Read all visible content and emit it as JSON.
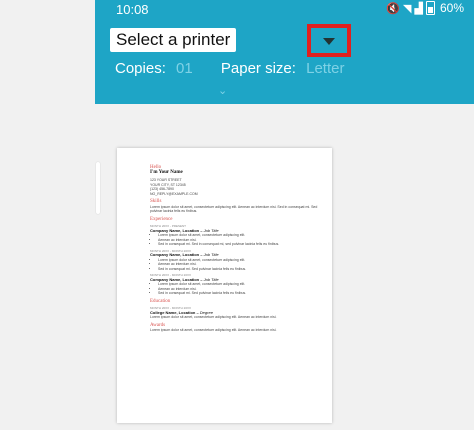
{
  "status": {
    "time": "10:08",
    "battery": "60%"
  },
  "printer": {
    "label": "Select a printer"
  },
  "settings": {
    "copies_label": "Copies:",
    "copies_value": "01",
    "paper_label": "Paper size:",
    "paper_value": "Letter"
  },
  "doc": {
    "hello": "Hello",
    "name": "I'm Your Name",
    "address": [
      "123 YOUR STREET",
      "YOUR CITY, ST 12345",
      "(123) 456-7890",
      "NO_REPLY@EXAMPLE.COM"
    ],
    "skills_heading": "Skills",
    "skills_text": "Lorem ipsum dolor sit amet, consectetuer adipiscing elit. Aenean ac interdum nisi. Sed in consequat mi. Sed pulvinar lacinia felis eu finibus.",
    "experience_heading": "Experience",
    "jobs": [
      {
        "date": "MONTH 20XX - PRESENT",
        "title": "Company Name, Location",
        "role": "Job Title",
        "bullets": [
          "Lorem ipsum dolor sit amet, consectetuer adipiscing elit.",
          "Aenean ac interdum nisi.",
          "Sed in consequat mi. Sed in consequat mi, sed pulvinar lacinia felis eu finibus."
        ]
      },
      {
        "date": "MONTH 20XX - MONTH 20XX",
        "title": "Company Name, Location",
        "role": "Job Title",
        "bullets": [
          "Lorem ipsum dolor sit amet, consectetuer adipiscing elit.",
          "Aenean ac interdum nisi.",
          "Sed in consequat mi. Sed pulvinar lacinia felis eu finibus."
        ]
      },
      {
        "date": "MONTH 20XX - MONTH 20XX",
        "title": "Company Name, Location",
        "role": "Job Title",
        "bullets": [
          "Lorem ipsum dolor sit amet, consectetuer adipiscing elit.",
          "Aenean ac interdum nisi.",
          "Sed in consequat mi. Sed pulvinar lacinia felis eu finibus."
        ]
      }
    ],
    "education_heading": "Education",
    "edu_date": "MONTH 20XX - MONTH 20XX",
    "edu_title": "College Name, Location",
    "edu_degree": "Degree",
    "edu_text": "Lorem ipsum dolor sit amet, consectetuer adipiscing elit. Aenean ac interdum nisi.",
    "awards_heading": "Awards",
    "awards_text": "Lorem ipsum dolor sit amet, consectetuer adipiscing elit. Aenean ac interdum nisi."
  },
  "colors": {
    "header": "#1ea5c6",
    "highlight": "#e0201f",
    "heading": "#d9534f"
  }
}
